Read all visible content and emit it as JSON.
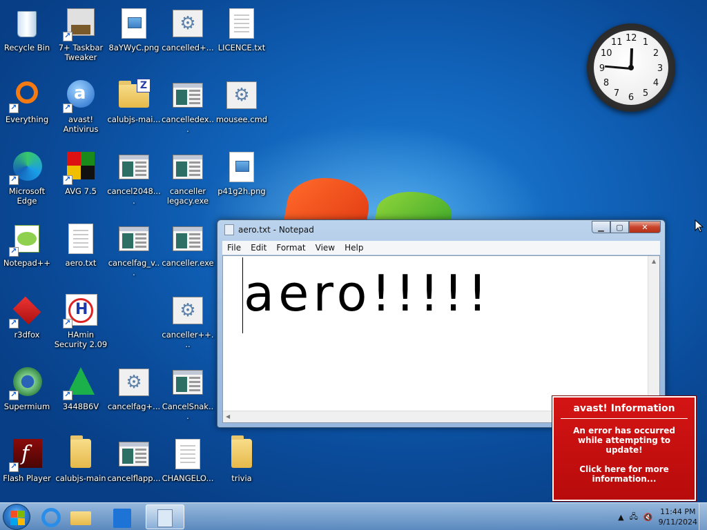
{
  "desktop": {
    "icons": [
      {
        "label": "Recycle Bin",
        "icon": "recycle-bin-icon"
      },
      {
        "label": "7+ Taskbar Tweaker",
        "icon": "taskbar-tweaker-icon"
      },
      {
        "label": "8aYWyC.png",
        "icon": "image-file-icon"
      },
      {
        "label": "cancelled+...",
        "icon": "cmd-script-icon"
      },
      {
        "label": "LICENCE.txt",
        "icon": "text-file-icon"
      },
      {
        "label": "Everything",
        "icon": "everything-search-icon"
      },
      {
        "label": "avast! Antivirus",
        "icon": "avast-antivirus-icon"
      },
      {
        "label": "calubjs-mai...",
        "icon": "zip-folder-icon"
      },
      {
        "label": "cancelledex...",
        "icon": "application-icon"
      },
      {
        "label": "mousee.cmd",
        "icon": "cmd-script-icon"
      },
      {
        "label": "Microsoft Edge",
        "icon": "edge-browser-icon"
      },
      {
        "label": "AVG 7.5",
        "icon": "avg-antivirus-icon"
      },
      {
        "label": "cancel2048....",
        "icon": "application-icon"
      },
      {
        "label": "canceller legacy.exe",
        "icon": "application-icon"
      },
      {
        "label": "p41g2h.png",
        "icon": "image-file-icon"
      },
      {
        "label": "Notepad++",
        "icon": "notepad-plus-plus-icon"
      },
      {
        "label": "aero.txt",
        "icon": "text-file-icon"
      },
      {
        "label": "cancelfag_v...",
        "icon": "application-icon"
      },
      {
        "label": "canceller.exe",
        "icon": "application-icon"
      },
      {
        "label": "r3dfox",
        "icon": "r3dfox-browser-icon"
      },
      {
        "label": "HAmin Security 2.09",
        "icon": "hamin-security-icon"
      },
      {
        "label": "canceller++...",
        "icon": "cmd-script-icon"
      },
      {
        "label": "Supermium",
        "icon": "supermium-browser-icon"
      },
      {
        "label": "3448B6V",
        "icon": "green-triangle-icon"
      },
      {
        "label": "cancelfag+...",
        "icon": "cmd-script-icon"
      },
      {
        "label": "CancelSnak...",
        "icon": "application-icon"
      },
      {
        "label": "Flash Player",
        "icon": "flash-player-icon"
      },
      {
        "label": "calubjs-main",
        "icon": "folder-icon"
      },
      {
        "label": "cancelflapp...",
        "icon": "application-icon"
      },
      {
        "label": "CHANGELO...",
        "icon": "text-file-icon"
      },
      {
        "label": "trivia",
        "icon": "folder-icon"
      }
    ]
  },
  "clock": {
    "time_display": "clock gadget"
  },
  "notepad": {
    "title": "aero.txt - Notepad",
    "menu": [
      "File",
      "Edit",
      "Format",
      "View",
      "Help"
    ],
    "content": "aero!!!!!",
    "buttons": {
      "minimize": "minimize",
      "maximize": "maximize",
      "close": "close"
    }
  },
  "avast_popup": {
    "title": "avast! Information",
    "message": "An error has occurred while attempting to update!",
    "link": "Click here for more information..."
  },
  "taskbar": {
    "pinned": [
      {
        "icon": "internet-explorer-icon"
      },
      {
        "icon": "file-explorer-icon"
      },
      {
        "icon": "store-icon"
      },
      {
        "icon": "notepad-icon"
      }
    ],
    "time": "11:44 PM",
    "date": "9/11/2024"
  },
  "colors": {
    "avast_red": "#c80f0f",
    "desktop_blue": "#0f5fb5"
  }
}
